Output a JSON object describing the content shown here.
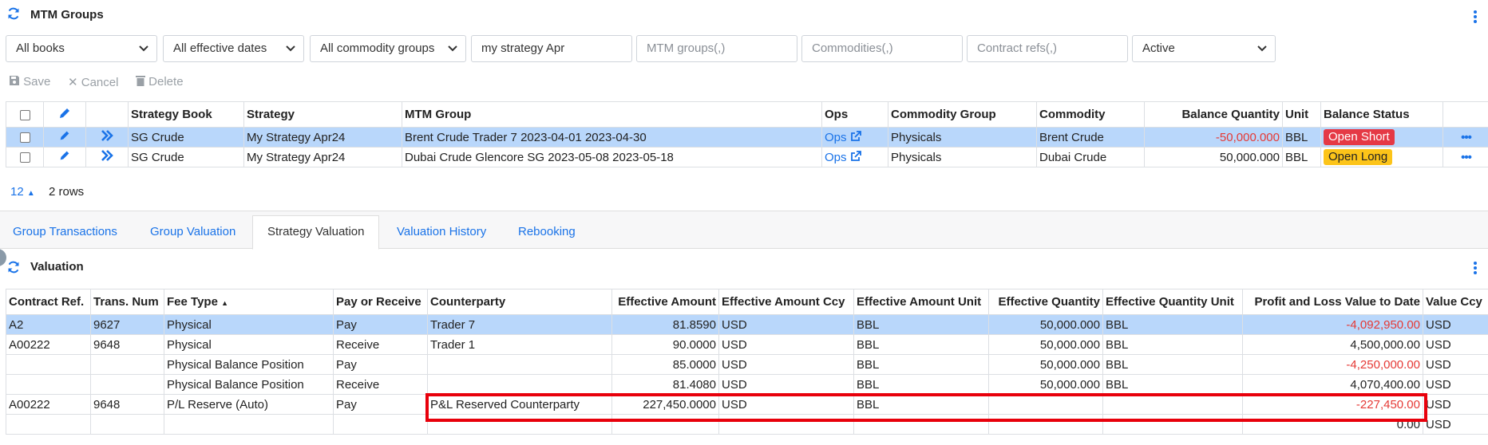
{
  "mtm_panel": {
    "title": "MTM Groups",
    "filters": {
      "books": "All books",
      "dates": "All effective dates",
      "commodity_groups": "All commodity groups",
      "strategy_search": "my strategy Apr",
      "mtm_groups_placeholder": "MTM groups(,)",
      "commodities_placeholder": "Commodities(,)",
      "contract_refs_placeholder": "Contract refs(,)",
      "status": "Active"
    },
    "toolbar": {
      "save": "Save",
      "cancel": "Cancel",
      "delete": "Delete"
    },
    "columns": [
      "Strategy Book",
      "Strategy",
      "MTM Group",
      "Ops",
      "Commodity Group",
      "Commodity",
      "Balance Quantity",
      "Unit",
      "Balance Status"
    ],
    "rows": [
      {
        "book": "SG Crude",
        "strategy": "My Strategy Apr24",
        "group": "Brent Crude Trader 7 2023-04-01 2023-04-30",
        "ops": "Ops",
        "commodity_group": "Physicals",
        "commodity": "Brent Crude",
        "balance": "-50,000.000",
        "unit": "BBL",
        "status": "Open Short"
      },
      {
        "book": "SG Crude",
        "strategy": "My Strategy Apr24",
        "group": "Dubai Crude Glencore SG 2023-05-08 2023-05-18",
        "ops": "Ops",
        "commodity_group": "Physicals",
        "commodity": "Dubai Crude",
        "balance": "50,000.000",
        "unit": "BBL",
        "status": "Open Long"
      }
    ],
    "page_size": "12",
    "row_count": "2 rows"
  },
  "colors": {
    "accent": "#1a73e8",
    "selected_row": "#b9d7fb",
    "negative": "#e53935",
    "open_short": "#e53945",
    "open_long": "#fcc419",
    "highlight": "#e8000b"
  },
  "tabs": [
    "Group Transactions",
    "Group Valuation",
    "Strategy Valuation",
    "Valuation History",
    "Rebooking"
  ],
  "active_tab": "Strategy Valuation",
  "valuation": {
    "title": "Valuation",
    "columns": [
      "Contract Ref.",
      "Trans. Num",
      "Fee Type",
      "Pay or Receive",
      "Counterparty",
      "Effective Amount",
      "Effective Amount Ccy",
      "Effective Amount Unit",
      "Effective Quantity",
      "Effective Quantity Unit",
      "Profit and Loss Value to Date",
      "Value Ccy"
    ],
    "rows": [
      {
        "ref": "A2",
        "num": "9627",
        "fee": "Physical",
        "pr": "Pay",
        "cp": "Trader 7",
        "amount": "81.8590",
        "ccy": "USD",
        "unit": "BBL",
        "qty": "50,000.000",
        "qunit": "BBL",
        "pnl": "-4,092,950.00",
        "vccy": "USD"
      },
      {
        "ref": "A00222",
        "num": "9648",
        "fee": "Physical",
        "pr": "Receive",
        "cp": "Trader 1",
        "amount": "90.0000",
        "ccy": "USD",
        "unit": "BBL",
        "qty": "50,000.000",
        "qunit": "BBL",
        "pnl": "4,500,000.00",
        "vccy": "USD"
      },
      {
        "ref": "",
        "num": "",
        "fee": "Physical Balance Position",
        "pr": "Pay",
        "cp": "",
        "amount": "85.0000",
        "ccy": "USD",
        "unit": "BBL",
        "qty": "50,000.000",
        "qunit": "BBL",
        "pnl": "-4,250,000.00",
        "vccy": "USD"
      },
      {
        "ref": "",
        "num": "",
        "fee": "Physical Balance Position",
        "pr": "Receive",
        "cp": "",
        "amount": "81.4080",
        "ccy": "USD",
        "unit": "BBL",
        "qty": "50,000.000",
        "qunit": "BBL",
        "pnl": "4,070,400.00",
        "vccy": "USD"
      },
      {
        "ref": "A00222",
        "num": "9648",
        "fee": "P/L Reserve (Auto)",
        "pr": "Pay",
        "cp": "P&L Reserved Counterparty",
        "amount": "227,450.0000",
        "ccy": "USD",
        "unit": "BBL",
        "qty": "",
        "qunit": "",
        "pnl": "-227,450.00",
        "vccy": "USD"
      },
      {
        "ref": "",
        "num": "",
        "fee": "",
        "pr": "",
        "cp": "",
        "amount": "",
        "ccy": "",
        "unit": "",
        "qty": "",
        "qunit": "",
        "pnl": "0.00",
        "vccy": "USD"
      }
    ]
  }
}
